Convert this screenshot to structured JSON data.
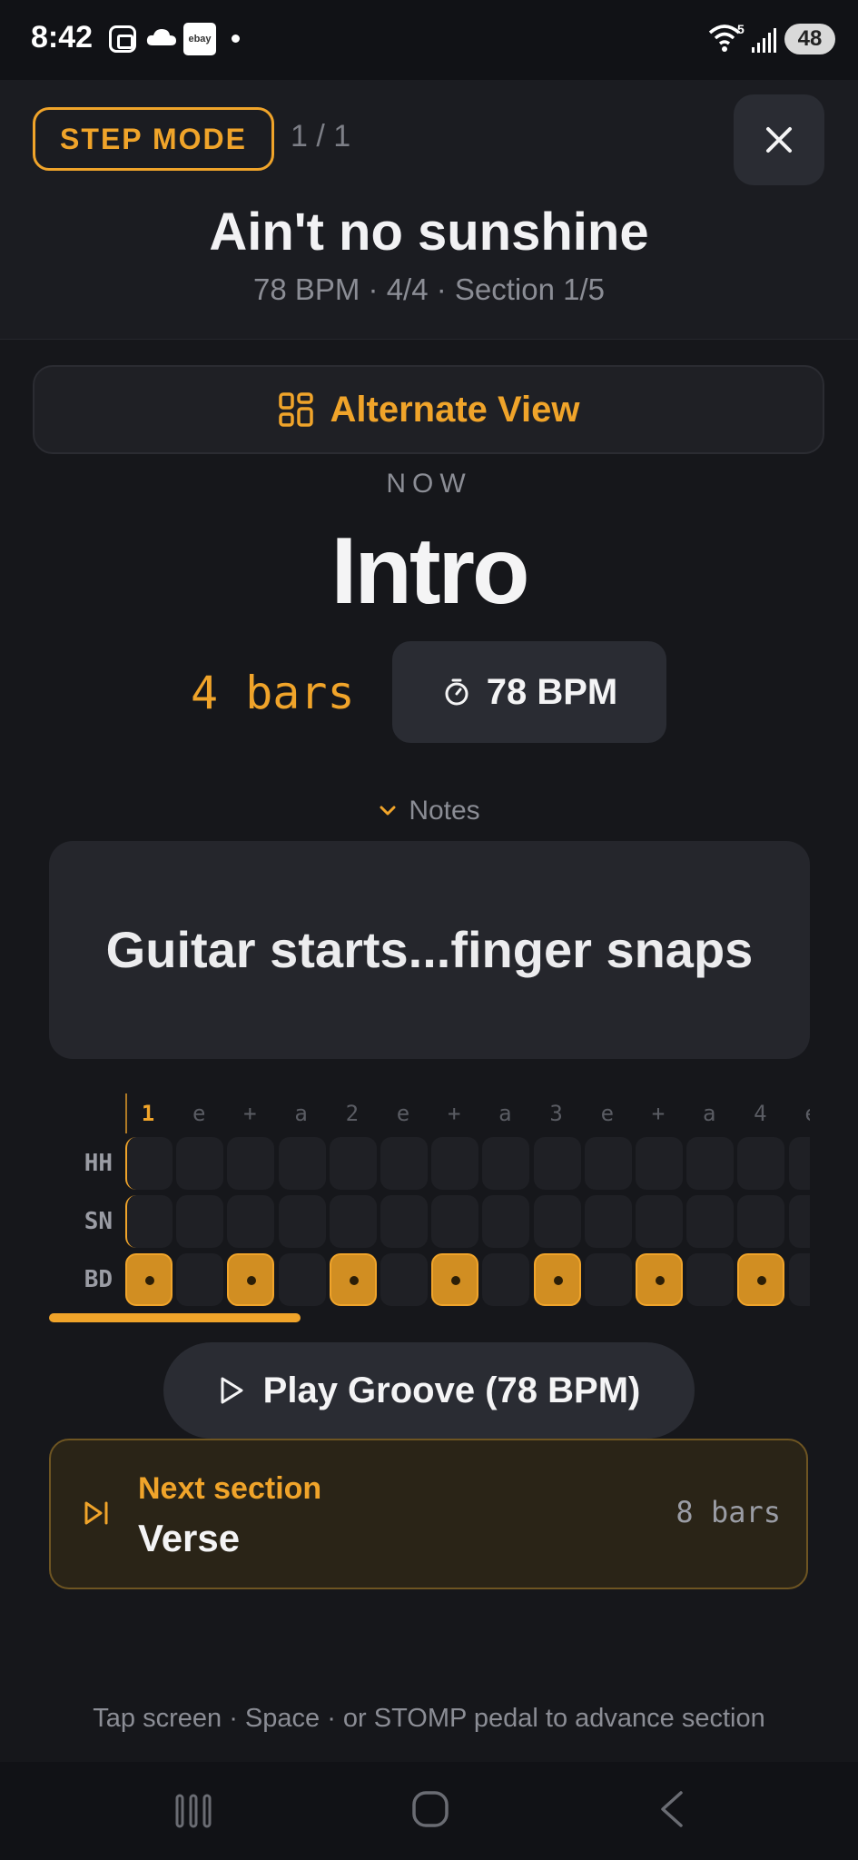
{
  "status_bar": {
    "time": "8:42",
    "ebay_label": "ebay",
    "wifi_badge": "5",
    "battery": "48",
    "icons": [
      "screenshot-icon",
      "cloud-icon",
      "ebay-icon",
      "wifi-icon",
      "signal-icon",
      "battery-icon"
    ]
  },
  "header": {
    "mode_badge": "STEP MODE",
    "step_count": "1 / 1",
    "close_icon": "close-icon",
    "song_title": "Ain't no sunshine",
    "song_meta": "78 BPM · 4/4 · Section 1/5"
  },
  "alternate_view": {
    "label": "Alternate View",
    "icon": "grid-icon"
  },
  "current_section": {
    "now_label": "NOW",
    "name": "Intro",
    "bars": "4 bars",
    "bpm_chip": "78 BPM",
    "bpm_icon": "stopwatch-icon"
  },
  "notes": {
    "toggle_label": "Notes",
    "text": "Guitar starts...finger snaps"
  },
  "groove": {
    "beat_labels": [
      "1",
      "e",
      "+",
      "a",
      "2",
      "e",
      "+",
      "a",
      "3",
      "e",
      "+",
      "a",
      "4",
      "e"
    ],
    "rows": [
      {
        "label": "HH",
        "hits": [
          0,
          0,
          0,
          0,
          0,
          0,
          0,
          0,
          0,
          0,
          0,
          0,
          0,
          0
        ]
      },
      {
        "label": "SN",
        "hits": [
          0,
          0,
          0,
          0,
          0,
          0,
          0,
          0,
          0,
          0,
          0,
          0,
          0,
          0
        ]
      },
      {
        "label": "BD",
        "hits": [
          1,
          0,
          1,
          0,
          1,
          0,
          1,
          0,
          1,
          0,
          1,
          0,
          1,
          0
        ]
      }
    ],
    "progress_fraction": 0.33,
    "play_button": "Play Groove (78 BPM)"
  },
  "next_section": {
    "label": "Next section",
    "name": "Verse",
    "bars": "8 bars",
    "icon": "skip-next-icon"
  },
  "hint": "Tap screen · Space · or STOMP pedal to advance section",
  "colors": {
    "accent": "#f0a42a",
    "background": "#16171b",
    "card": "#25262c",
    "muted_text": "#8b8d95"
  }
}
